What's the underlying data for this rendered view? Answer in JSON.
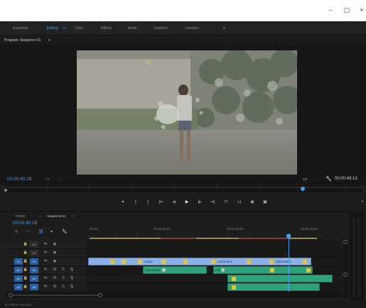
{
  "window": {
    "min_label": "–",
    "restore_label": "▢",
    "close_label": "×"
  },
  "workspaces": [
    {
      "label": "Assembly"
    },
    {
      "label": "Editing",
      "active": true
    },
    {
      "label": "Color"
    },
    {
      "label": "Effects"
    },
    {
      "label": "Audio"
    },
    {
      "label": "Graphics"
    },
    {
      "label": "Libraries"
    },
    {
      "label": "»"
    }
  ],
  "program_monitor": {
    "title": "Program: Sequence 01",
    "menu_icon": "≡",
    "timecode": "00:00:40:19",
    "fit": "Fit",
    "quality": "1/2",
    "duration": "00:00:49:13"
  },
  "timeline": {
    "clip_tab": "C0034",
    "sequence_tab": "Sequence 01",
    "menu_icon": "≡",
    "timecode": "00:00:40:19",
    "ruler": [
      "-00:00",
      "00:00:15:00",
      "00:00:30:00",
      "00:00:45:00"
    ],
    "tracks": [
      {
        "label": "V3"
      },
      {
        "label": "V2"
      },
      {
        "label": "V1"
      },
      {
        "label": "A1",
        "m": "M",
        "s": "S"
      },
      {
        "label": "A2",
        "m": "M",
        "s": "S"
      },
      {
        "label": "A3",
        "m": "M",
        "s": "S"
      }
    ],
    "video_clips": [
      "C0034",
      "C0031.MP4",
      "C0033.MP4"
    ],
    "audio_clips": [
      "C0034.MP4",
      "C0031"
    ]
  },
  "status": "No effects selected",
  "colors": {
    "accent": "#4a9ce8",
    "video_clip": "#8ab1e6",
    "audio_clip": "#2ea37b",
    "fx_badge": "#e8c237"
  }
}
